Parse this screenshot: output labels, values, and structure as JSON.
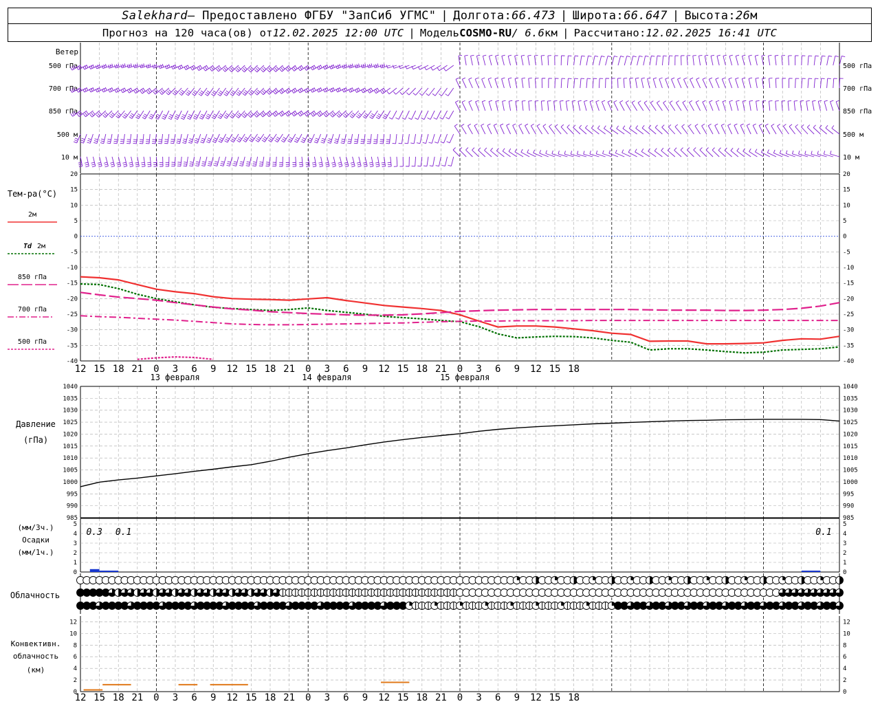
{
  "header": {
    "station": "Salekhard",
    "provider": " – Предоставлено ФГБУ \"ЗапСиб УГМС\"",
    "lon_label": "Долгота: ",
    "lon": "66.473",
    "lat_label": "Широта: ",
    "lat": "66.647",
    "alt_label": "Высота: ",
    "alt": "26",
    "alt_unit": "м",
    "forecast_label": "Прогноз на 120 часа(ов) от ",
    "forecast_start": "12.02.2025 12:00 UTC",
    "model_label": "Модель ",
    "model": "COSMO-RU",
    "resolution": " / 6.6",
    "res_unit": "км",
    "computed_label": "Рассчитано: ",
    "computed": "12.02.2025 16:41 UTC"
  },
  "labels": {
    "wind": "Ветер",
    "temp": "Тем-ра(°C)",
    "t2m": "2м",
    "td_sym": "Td",
    "td2m": "2м",
    "t850": "850 гПа",
    "t700": "700 гПа",
    "t500": "500 гПа",
    "pressure1": "Давление",
    "pressure2": "(гПа)",
    "precip1": "(мм/3ч.)",
    "precip2": "Осадки",
    "precip3": "(мм/1ч.)",
    "cloud": "Облачность",
    "conv1": "Конвективн.",
    "conv2": "облачность",
    "conv3": "(км)"
  },
  "dates": [
    "13 февраля",
    "14 февраля",
    "15 февраля"
  ],
  "colors": {
    "t2m": "#f03030",
    "td2m": "#007000",
    "t850": "#e0208c",
    "t700": "#e0208c",
    "t500": "#e0208c",
    "wind": "#8020d0",
    "zero_line": "#3050e0",
    "precip": "#1838d0",
    "conv": "#e07818",
    "grid": "#a8a8a8"
  },
  "chart_data": [
    {
      "type": "wind-barbs",
      "levels": [
        "500 гПа",
        "700 гПа",
        "850 гПа",
        "500 м",
        "10 м"
      ],
      "x_hours_from_start": [
        0,
        120
      ],
      "level_mean_direction_deg": [
        240,
        230,
        220,
        200,
        180
      ]
    },
    {
      "type": "line",
      "name": "temperature",
      "x_ticks": [
        "12",
        "15",
        "18",
        "21",
        "0",
        "3",
        "6",
        "9",
        "12",
        "15",
        "18",
        "21",
        "0",
        "3",
        "6",
        "9",
        "12",
        "15",
        "18",
        "21",
        "0",
        "3",
        "6",
        "9",
        "12",
        "15",
        "18"
      ],
      "ylim": [
        -40,
        20
      ],
      "y_ticks": [
        20,
        15,
        10,
        5,
        0,
        -5,
        -10,
        -15,
        -20,
        -25,
        -30,
        -35,
        -40
      ],
      "x": [
        0,
        3,
        6,
        9,
        12,
        15,
        18,
        21,
        24,
        27,
        30,
        33,
        36,
        39,
        42,
        45,
        48,
        51,
        54,
        57,
        60,
        63,
        66,
        69,
        72,
        75,
        78,
        81,
        84,
        87,
        90,
        93,
        96,
        99,
        102,
        105,
        108,
        111,
        114,
        117,
        120
      ],
      "series": [
        {
          "name": "2м",
          "values": [
            -13,
            -13.3,
            -14,
            -15.5,
            -17,
            -17.8,
            -18.4,
            -19.4,
            -20,
            -20.2,
            -20.3,
            -20.5,
            -20.1,
            -19.7,
            -20.6,
            -21.4,
            -22.2,
            -22.7,
            -23.2,
            -23.8,
            -25.2,
            -27.2,
            -29.1,
            -28.8,
            -28.8,
            -29.1,
            -29.7,
            -30.3,
            -31.1,
            -31.5,
            -33.7,
            -33.6,
            -33.6,
            -34.5,
            -34.5,
            -34.4,
            -34.2,
            -33.4,
            -32.9,
            -33.0,
            -32.1
          ]
        },
        {
          "name": "Td 2м",
          "values": [
            -15.3,
            -15.5,
            -16.8,
            -18.6,
            -20,
            -21,
            -22,
            -22.8,
            -23.2,
            -23.5,
            -23.8,
            -23.5,
            -23,
            -23.8,
            -24.4,
            -25,
            -25.7,
            -26.1,
            -26.5,
            -27,
            -27.4,
            -29,
            -31.3,
            -32.6,
            -32.3,
            -32.1,
            -32.2,
            -32.6,
            -33.4,
            -34,
            -36.5,
            -36.1,
            -36.1,
            -36.5,
            -37,
            -37.4,
            -37.2,
            -36.5,
            -36.3,
            -36.1,
            -35.5
          ]
        },
        {
          "name": "850 гПа",
          "values": [
            -18,
            -18.8,
            -19.5,
            -20,
            -20.5,
            -21.3,
            -22,
            -22.7,
            -23.3,
            -23.7,
            -24.2,
            -24.5,
            -24.8,
            -25,
            -25.2,
            -25.3,
            -25.3,
            -25.2,
            -24.9,
            -24.5,
            -24.1,
            -23.9,
            -23.7,
            -23.6,
            -23.5,
            -23.5,
            -23.5,
            -23.5,
            -23.5,
            -23.5,
            -23.6,
            -23.7,
            -23.7,
            -23.7,
            -23.8,
            -23.8,
            -23.7,
            -23.5,
            -23.1,
            -22.4,
            -21.3
          ]
        },
        {
          "name": "700 гПа",
          "values": [
            -25.5,
            -25.8,
            -26,
            -26.3,
            -26.6,
            -26.9,
            -27.3,
            -27.7,
            -28.1,
            -28.3,
            -28.4,
            -28.4,
            -28.3,
            -28.2,
            -28.1,
            -28,
            -27.9,
            -27.8,
            -27.6,
            -27.4,
            -27.3,
            -27.2,
            -27.2,
            -27.1,
            -27.1,
            -27.1,
            -27.1,
            -27,
            -27,
            -27,
            -27,
            -27,
            -27,
            -27,
            -27,
            -27,
            -27,
            -27,
            -27,
            -27,
            -27
          ]
        },
        {
          "name": "500 гПа",
          "values": [
            null,
            null,
            null,
            -39.5,
            -39.0,
            -38.7,
            -38.9,
            -39.5,
            null,
            null,
            null,
            null,
            null,
            null,
            null,
            null,
            null,
            null,
            null,
            null,
            null,
            null,
            null,
            null,
            null,
            null,
            null,
            null,
            null,
            null,
            null,
            null,
            null,
            null,
            null,
            null,
            null,
            null,
            null,
            null,
            null
          ]
        }
      ]
    },
    {
      "type": "line",
      "name": "pressure",
      "ylim": [
        985,
        1040
      ],
      "y_ticks": [
        1040,
        1035,
        1030,
        1025,
        1020,
        1015,
        1010,
        1005,
        1000,
        995,
        990,
        985
      ],
      "x": [
        0,
        3,
        6,
        9,
        12,
        15,
        18,
        21,
        24,
        27,
        30,
        33,
        36,
        39,
        42,
        45,
        48,
        51,
        54,
        57,
        60,
        63,
        66,
        69,
        72,
        75,
        78,
        81,
        84,
        87,
        90,
        93,
        96,
        99,
        102,
        105,
        108,
        111,
        114,
        117,
        120
      ],
      "values": [
        998,
        999.9,
        1000.8,
        1001.6,
        1002.5,
        1003.4,
        1004.4,
        1005.3,
        1006.3,
        1007.2,
        1008.6,
        1010.3,
        1011.8,
        1013.1,
        1014.2,
        1015.5,
        1016.7,
        1017.7,
        1018.6,
        1019.4,
        1020.2,
        1021.2,
        1022,
        1022.6,
        1023.1,
        1023.5,
        1023.9,
        1024.3,
        1024.6,
        1024.9,
        1025.2,
        1025.5,
        1025.7,
        1025.8,
        1026,
        1026.1,
        1026.2,
        1026.2,
        1026.2,
        1026.1,
        1025.5
      ]
    },
    {
      "type": "bar",
      "name": "precipitation",
      "ylim": [
        0,
        5
      ],
      "y_ticks": [
        5,
        4,
        3,
        2,
        1,
        0
      ],
      "bars": [
        {
          "x0": 1.5,
          "x1": 3,
          "value": 0.3
        },
        {
          "x0": 3,
          "x1": 6,
          "value": 0.1
        },
        {
          "x0": 114,
          "x1": 117,
          "value": 0.1
        }
      ],
      "annotations": [
        {
          "x": 2.2,
          "text": "0.3"
        },
        {
          "x": 6.8,
          "text": "0.1"
        },
        {
          "x": 117.5,
          "text": "0.1"
        }
      ]
    },
    {
      "type": "cloud-cover",
      "rows": [
        "high",
        "mid",
        "low"
      ],
      "x_hours_from_start": [
        0,
        120
      ],
      "note": "octa symbols per hour"
    },
    {
      "type": "bar",
      "name": "convective-cloud",
      "ylim": [
        0,
        13
      ],
      "y_ticks": [
        12,
        10,
        8,
        6,
        4,
        2,
        0
      ],
      "segments": [
        {
          "x0": 0.5,
          "x1": 3.5,
          "value": 0.3
        },
        {
          "x0": 3.5,
          "x1": 8,
          "value": 1.2
        },
        {
          "x0": 15.5,
          "x1": 18.5,
          "value": 1.2
        },
        {
          "x0": 20.5,
          "x1": 26.5,
          "value": 1.2
        },
        {
          "x0": 47.5,
          "x1": 52,
          "value": 1.6
        }
      ]
    }
  ]
}
